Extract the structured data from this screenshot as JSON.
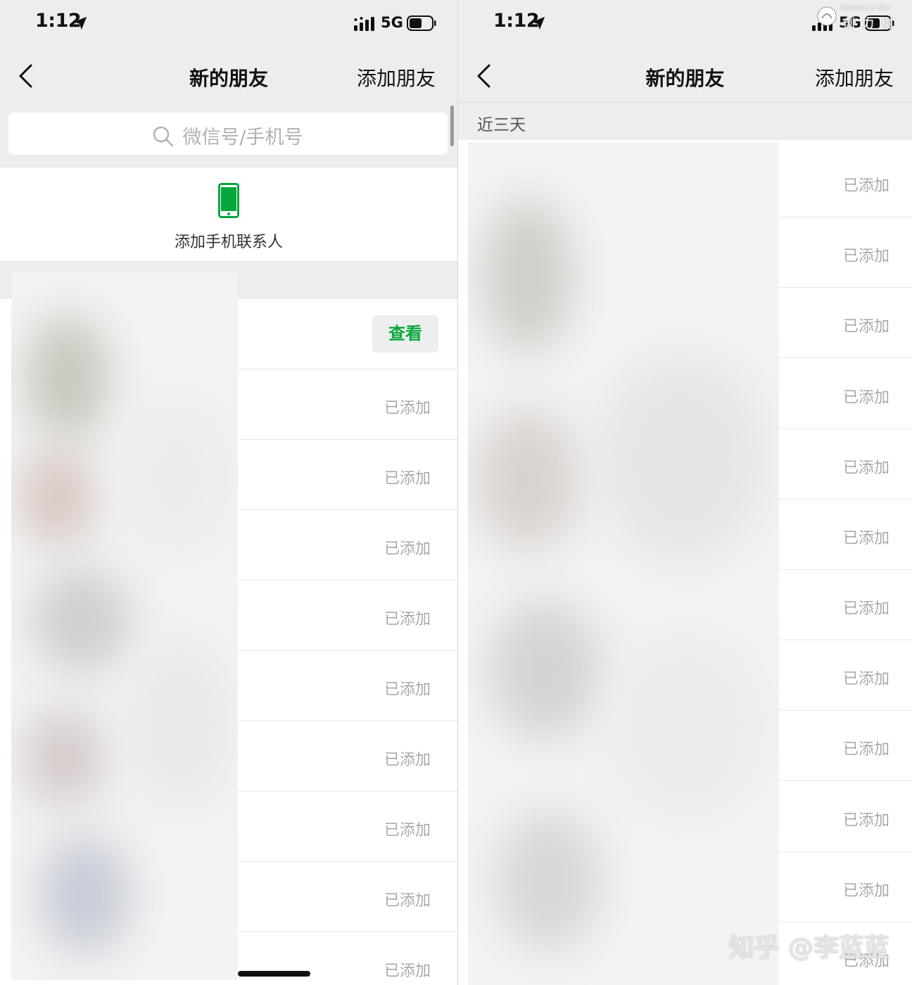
{
  "left": {
    "status_bar": {
      "time": "1:12",
      "network": "5G"
    },
    "nav": {
      "title": "新的朋友",
      "action": "添加朋友"
    },
    "search": {
      "placeholder": "微信号/手机号"
    },
    "add_contacts": {
      "label": "添加手机联系人"
    },
    "first_row_action": "查看",
    "rows_status": [
      "已添加",
      "已添加",
      "已添加",
      "已添加",
      "已添加",
      "已添加",
      "已添加",
      "已添加",
      "已添加"
    ]
  },
  "right": {
    "status_bar": {
      "time": "1:12",
      "network": "5G"
    },
    "nav": {
      "title": "新的朋友",
      "action": "添加朋友"
    },
    "section_header": "近三天",
    "rows_status": [
      "已添加",
      "已添加",
      "已添加",
      "已添加",
      "已添加",
      "已添加",
      "已添加",
      "已添加",
      "已添加",
      "已添加",
      "已添加",
      "已添加"
    ]
  },
  "watermark": "知乎 @李蓝蓝",
  "brand_logo": {
    "small": "CHUANG LI SHU",
    "big": "创力树"
  },
  "colors": {
    "accent_green": "#07a63d",
    "nav_background": "#ededed",
    "muted_text": "#a9a9a9"
  }
}
